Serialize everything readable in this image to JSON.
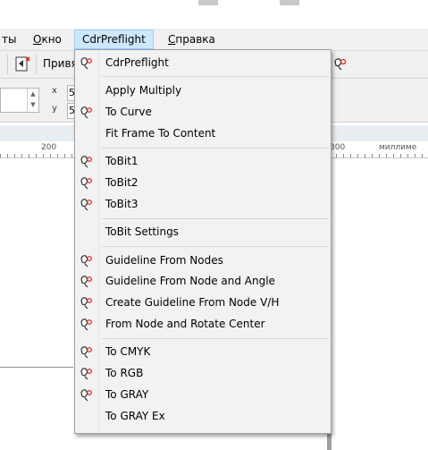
{
  "menubar": {
    "items": [
      {
        "label": "ты",
        "accel": ""
      },
      {
        "label": "Окно",
        "accel": "О"
      },
      {
        "label": "CdrPreflight",
        "accel": ""
      },
      {
        "label": "Справка",
        "accel": "С"
      }
    ]
  },
  "toolbar": {
    "snap_label": "Привя"
  },
  "propbar": {
    "x_value": "5",
    "y_value": "5"
  },
  "ruler": {
    "tick_200": "200",
    "tick_300": "300",
    "units": "миллиме"
  },
  "dropdown": {
    "items": [
      {
        "label": "CdrPreflight",
        "icon": "cdr-plugin-icon"
      },
      {
        "label": "Apply Multiply",
        "icon": ""
      },
      {
        "label": "To Curve",
        "icon": "cdr-plugin-icon"
      },
      {
        "label": "Fit Frame To Content",
        "icon": ""
      },
      {
        "label": "ToBit1",
        "icon": "cdr-plugin-icon"
      },
      {
        "label": "ToBit2",
        "icon": "cdr-plugin-icon"
      },
      {
        "label": "ToBit3",
        "icon": "cdr-plugin-icon"
      },
      {
        "label": "ToBit Settings",
        "icon": ""
      },
      {
        "label": "Guideline From Nodes",
        "icon": "cdr-plugin-icon"
      },
      {
        "label": "Guideline From Node and Angle",
        "icon": "cdr-plugin-icon"
      },
      {
        "label": "Create Guideline From Node V/H",
        "icon": "cdr-plugin-icon"
      },
      {
        "label": "From Node and Rotate Center",
        "icon": "cdr-plugin-icon"
      },
      {
        "label": "To CMYK",
        "icon": "cdr-plugin-icon"
      },
      {
        "label": "To RGB",
        "icon": "cdr-plugin-icon"
      },
      {
        "label": "To GRAY",
        "icon": "cdr-plugin-icon"
      },
      {
        "label": "To GRAY Ex",
        "icon": ""
      }
    ]
  },
  "colors": {
    "menu_active_bg": "#cce8ff",
    "menu_active_border": "#99d1ff",
    "icon_red": "#e02020"
  }
}
